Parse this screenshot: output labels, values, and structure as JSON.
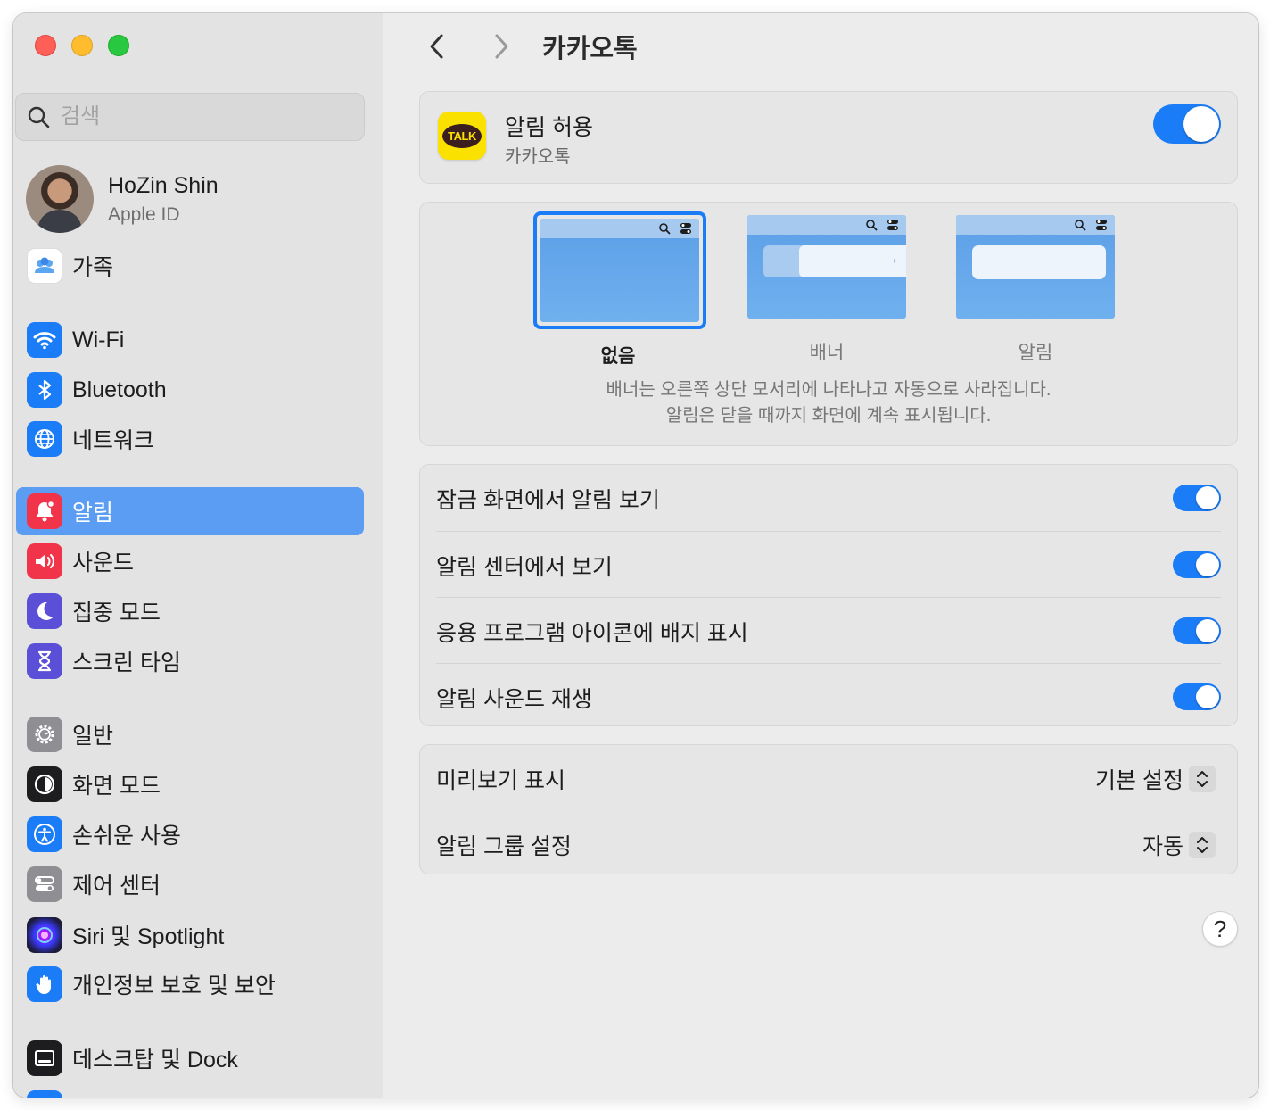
{
  "sidebar": {
    "search_placeholder": "검색",
    "profile": {
      "name": "HoZin Shin",
      "subtitle": "Apple ID"
    },
    "items": [
      {
        "label": "가족",
        "icon": "family-icon",
        "color": "#ffffff"
      },
      {
        "label": "Wi-Fi",
        "icon": "wifi-icon",
        "color": "#1a7cf6"
      },
      {
        "label": "Bluetooth",
        "icon": "bluetooth-icon",
        "color": "#1a7cf6"
      },
      {
        "label": "네트워크",
        "icon": "globe-icon",
        "color": "#1a7cf6"
      },
      {
        "label": "알림",
        "icon": "bell-icon",
        "color": "#f2344a",
        "selected": true
      },
      {
        "label": "사운드",
        "icon": "speaker-icon",
        "color": "#f2344a"
      },
      {
        "label": "집중 모드",
        "icon": "moon-icon",
        "color": "#5b4fd8"
      },
      {
        "label": "스크린 타임",
        "icon": "hourglass-icon",
        "color": "#5b4fd8"
      },
      {
        "label": "일반",
        "icon": "gear-icon",
        "color": "#8e8e93"
      },
      {
        "label": "화면 모드",
        "icon": "appearance-icon",
        "color": "#1d1d1f"
      },
      {
        "label": "손쉬운 사용",
        "icon": "accessibility-icon",
        "color": "#1a7cf6"
      },
      {
        "label": "제어 센터",
        "icon": "control-center-icon",
        "color": "#8e8e93"
      },
      {
        "label": "Siri 및 Spotlight",
        "icon": "siri-icon",
        "color": "#3a3a8c"
      },
      {
        "label": "개인정보 보호 및 보안",
        "icon": "hand-icon",
        "color": "#1a7cf6"
      },
      {
        "label": "데스크탑 및 Dock",
        "icon": "dock-icon",
        "color": "#1d1d1f"
      }
    ]
  },
  "header": {
    "title": "카카오톡"
  },
  "app": {
    "icon_text": "TALK",
    "allow_title": "알림 허용",
    "allow_subtitle": "카카오톡",
    "allow_enabled": true
  },
  "alert_style": {
    "options": [
      {
        "label": "없음",
        "selected": true
      },
      {
        "label": "배너",
        "selected": false
      },
      {
        "label": "알림",
        "selected": false
      }
    ],
    "description_line1": "배너는 오른쪽 상단 모서리에 나타나고 자동으로 사라집니다.",
    "description_line2": "알림은 닫을 때까지 화면에 계속 표시됩니다."
  },
  "toggles": [
    {
      "label": "잠금 화면에서 알림 보기",
      "on": true
    },
    {
      "label": "알림 센터에서 보기",
      "on": true
    },
    {
      "label": "응용 프로그램 아이콘에 배지 표시",
      "on": true
    },
    {
      "label": "알림 사운드 재생",
      "on": true
    }
  ],
  "selects": [
    {
      "label": "미리보기 표시",
      "value": "기본 설정"
    },
    {
      "label": "알림 그룹 설정",
      "value": "자동"
    }
  ],
  "help_label": "?",
  "colors": {
    "accent": "#1a7cf6",
    "sidebar_selected": "#5b9df2"
  }
}
